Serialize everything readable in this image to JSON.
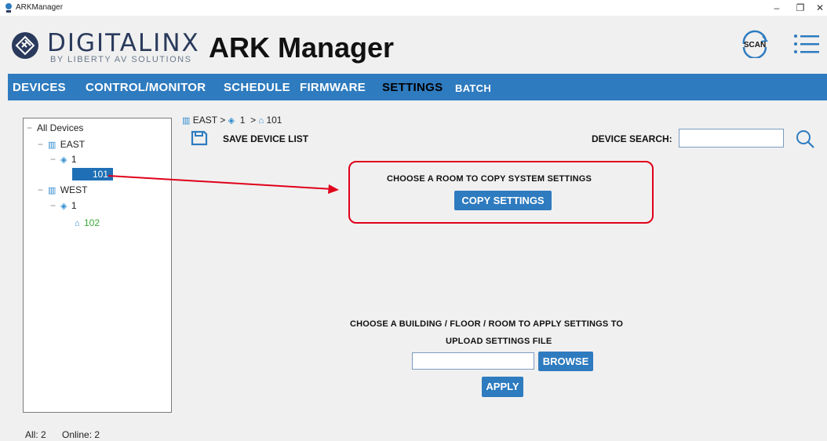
{
  "window": {
    "title": "ARKManager",
    "minimize": "–",
    "maximize": "❐",
    "close": "✕"
  },
  "header": {
    "brand": "DIGITALINX",
    "brand_sub": "BY LIBERTY AV SOLUTIONS",
    "app_title": "ARK Manager",
    "scan_label": "SCAN",
    "brand_color": "#2a3a5c"
  },
  "nav": {
    "items": [
      {
        "label": "DEVICES"
      },
      {
        "label": "CONTROL/MONITOR"
      },
      {
        "label": "SCHEDULE"
      },
      {
        "label": "FIRMWARE"
      },
      {
        "label": "SETTINGS"
      },
      {
        "label": "BATCH"
      }
    ],
    "active": "SETTINGS",
    "bar_color": "#2e7bbf"
  },
  "tree": {
    "root": "All Devices",
    "buildings": [
      {
        "name": "EAST",
        "floors": [
          {
            "name": "1",
            "rooms": [
              {
                "name": "101",
                "selected": true
              }
            ]
          }
        ]
      },
      {
        "name": "WEST",
        "floors": [
          {
            "name": "1",
            "rooms": [
              {
                "name": "102",
                "online": true
              }
            ]
          }
        ]
      }
    ]
  },
  "breadcrumb": {
    "building": "EAST",
    "sep1": ">",
    "floor": "1",
    "sep2": ">",
    "room": "101"
  },
  "toolbar": {
    "save_label": "SAVE DEVICE LIST",
    "search_label": "DEVICE SEARCH:",
    "search_value": ""
  },
  "copy_section": {
    "prompt": "CHOOSE A ROOM TO COPY SYSTEM SETTINGS",
    "button": "COPY SETTINGS",
    "highlight_color": "#e0001b"
  },
  "apply_section": {
    "prompt": "CHOOSE A BUILDING / FLOOR / ROOM TO APPLY SETTINGS TO",
    "upload_label": "UPLOAD SETTINGS FILE",
    "file_value": "",
    "browse_button": "BROWSE",
    "apply_button": "APPLY"
  },
  "status": {
    "all": "All: 2",
    "online": "Online: 2"
  }
}
